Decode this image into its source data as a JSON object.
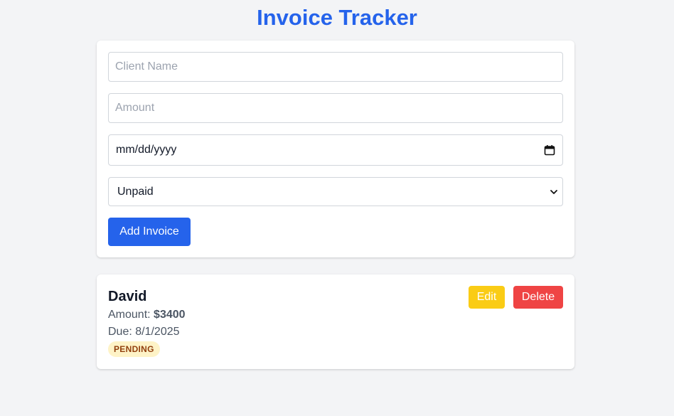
{
  "app": {
    "title": "Invoice Tracker"
  },
  "form": {
    "client_placeholder": "Client Name",
    "client_value": "",
    "amount_placeholder": "Amount",
    "amount_value": "",
    "date_text": "mm/dd/yyyy",
    "status_selected": "Unpaid",
    "submit_label": "Add Invoice"
  },
  "invoices": [
    {
      "client": "David",
      "amount_label": "Amount:",
      "amount": "$3400",
      "due_text": "Due: 8/1/2025",
      "status": "PENDING",
      "edit_label": "Edit",
      "delete_label": "Delete"
    }
  ],
  "colors": {
    "accent": "#2563eb",
    "edit": "#facc15",
    "delete": "#ef4444",
    "pending_bg": "#fef3c7",
    "pending_text": "#92400e",
    "background": "#f3f4f6"
  },
  "icons": {
    "date_picker": "calendar-icon",
    "status_dropdown": "chevron-down-icon"
  }
}
